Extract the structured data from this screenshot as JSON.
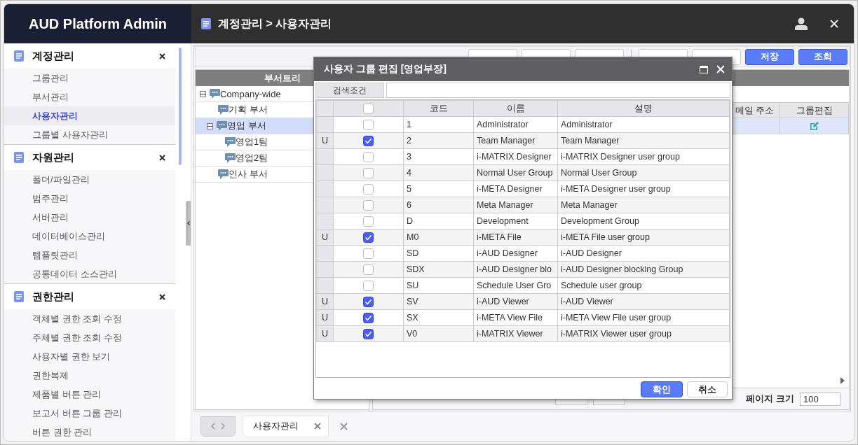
{
  "app_title": "AUD Platform Admin",
  "breadcrumb": "계정관리 > 사용자관리",
  "sidebar": {
    "sections": [
      {
        "title": "계정관리",
        "items": [
          {
            "label": "그룹관리",
            "selected": false
          },
          {
            "label": "부서관리",
            "selected": false
          },
          {
            "label": "사용자관리",
            "selected": true
          },
          {
            "label": "그룹별 사용자관리",
            "selected": false
          }
        ]
      },
      {
        "title": "자원관리",
        "items": [
          {
            "label": "폴더/파일관리",
            "selected": false
          },
          {
            "label": "범주관리",
            "selected": false
          },
          {
            "label": "서버관리",
            "selected": false
          },
          {
            "label": "데이터베이스관리",
            "selected": false
          },
          {
            "label": "템플릿관리",
            "selected": false
          },
          {
            "label": "공통데이터 소스관리",
            "selected": false
          }
        ]
      },
      {
        "title": "권한관리",
        "items": [
          {
            "label": "객체별 권한 조회 수정",
            "selected": false
          },
          {
            "label": "주체별 권한 조회 수정",
            "selected": false
          },
          {
            "label": "사용자별 권한 보기",
            "selected": false
          },
          {
            "label": "권한복제",
            "selected": false
          },
          {
            "label": "제품별 버튼 관리",
            "selected": false
          },
          {
            "label": "보고서 버튼 그룹 관리",
            "selected": false
          },
          {
            "label": "버튼 권한 관리",
            "selected": false
          }
        ]
      }
    ]
  },
  "toolbar": {
    "buttons": [
      {
        "kind": "plain"
      },
      {
        "kind": "plain"
      },
      {
        "kind": "plain"
      },
      {
        "kind": "separator"
      },
      {
        "kind": "plain"
      },
      {
        "kind": "plain"
      },
      {
        "kind": "primary",
        "label": "저장"
      },
      {
        "kind": "primary",
        "label": "조회"
      }
    ]
  },
  "tree": {
    "title": "부서트리",
    "nodes": [
      {
        "label": "Company-wide",
        "expanded": true,
        "selected": false,
        "children": [
          {
            "label": "기획 부서",
            "selected": false
          },
          {
            "label": "영업 부서",
            "expanded": true,
            "selected": true,
            "children": [
              {
                "label": "영업1팀",
                "selected": false
              },
              {
                "label": "영업2팀",
                "selected": false
              }
            ]
          },
          {
            "label": "인사 부서",
            "selected": false
          }
        ]
      }
    ]
  },
  "user_grid": {
    "columns": [
      "메일 주소",
      "그룹편집"
    ],
    "rows": [
      {
        "selected": true
      }
    ]
  },
  "pagination": {
    "page_size_label": "페이지 크기",
    "page_size": "100"
  },
  "tabs": [
    {
      "label": "사용자관리",
      "selected": true
    }
  ],
  "dialog": {
    "title": "사용자 그룹 편집 [영업부장]",
    "search_label": "검색조건",
    "header_checked": false,
    "columns": [
      "코드",
      "이름",
      "설명"
    ],
    "rows": [
      {
        "checked": false,
        "code": "1",
        "name": "Administrator",
        "description": "Administrator"
      },
      {
        "status": "U",
        "checked": true,
        "code": "2",
        "name": "Team Manager",
        "description": "Team Manager"
      },
      {
        "checked": false,
        "code": "3",
        "name": "i-MATRIX Designer",
        "description": "i-MATRIX Designer user group"
      },
      {
        "checked": false,
        "code": "4",
        "name": "Normal User Group",
        "description": "Normal User Group"
      },
      {
        "checked": false,
        "code": "5",
        "name": "i-META Designer",
        "description": "i-META Designer user group"
      },
      {
        "checked": false,
        "code": "6",
        "name": "Meta Manager",
        "description": "Meta Manager"
      },
      {
        "checked": false,
        "code": "D",
        "name": "Development",
        "description": "Development Group"
      },
      {
        "status": "U",
        "checked": true,
        "code": "M0",
        "name": "i-META File",
        "description": "i-META File user group"
      },
      {
        "checked": false,
        "code": "SD",
        "name": "i-AUD Designer",
        "description": "i-AUD Designer"
      },
      {
        "checked": false,
        "code": "SDX",
        "name": "i-AUD Designer blo",
        "description": "i-AUD Designer blocking Group"
      },
      {
        "checked": false,
        "code": "SU",
        "name": "Schedule User Gro",
        "description": "Schedule user group"
      },
      {
        "status": "U",
        "checked": true,
        "code": "SV",
        "name": "i-AUD Viewer",
        "description": "i-AUD Viewer"
      },
      {
        "status": "U",
        "checked": true,
        "code": "SX",
        "name": "i-META View File",
        "description": "i-META View File user group"
      },
      {
        "status": "U",
        "checked": true,
        "code": "V0",
        "name": "i-MATRIX Viewer",
        "description": "i-MATRIX Viewer user group"
      }
    ],
    "buttons": [
      {
        "kind": "primary",
        "label": "확인"
      },
      {
        "kind": "plain",
        "label": "취소"
      }
    ]
  }
}
